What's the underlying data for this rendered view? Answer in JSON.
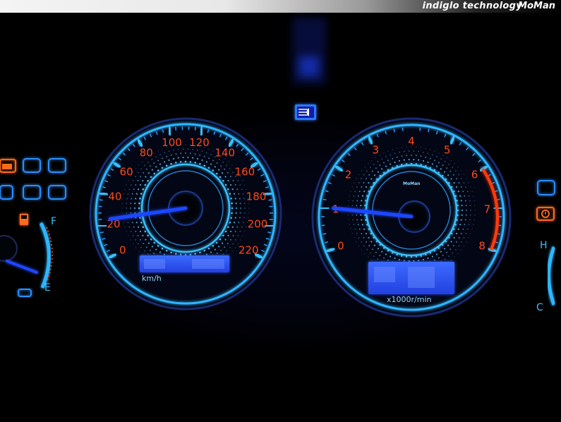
{
  "banner": {
    "text": "indiglo technology",
    "brand": "MoMan"
  },
  "speedometer": {
    "labels": [
      "0",
      "20",
      "40",
      "60",
      "80",
      "100",
      "120",
      "140",
      "160",
      "180",
      "200",
      "220"
    ],
    "unit": "km/h",
    "reading_kmh": 20
  },
  "tachometer": {
    "labels": [
      "0",
      "1",
      "2",
      "3",
      "4",
      "5",
      "6",
      "7",
      "8"
    ],
    "unit": "x1000r/min",
    "brand_small": "MoMan",
    "reading_x1000rpm": 1
  },
  "colors": {
    "glow": "#27a6ff",
    "numbers": "#ff4a1c",
    "needle": "#1e46ff",
    "lcd": "#2f55ff"
  },
  "icons": [
    "check-engine-icon",
    "fuel-pump-icon",
    "headlight-icon",
    "warning-icon"
  ]
}
